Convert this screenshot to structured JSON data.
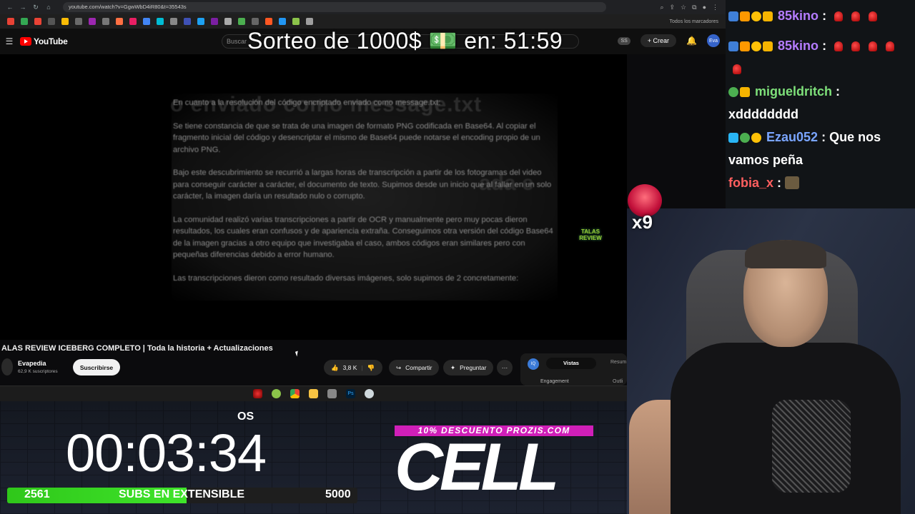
{
  "browser": {
    "url": "youtube.com/watch?v=GgwWbD4iR80&t=35543s",
    "bookmarks_folder": "Todos los marcadores"
  },
  "youtube": {
    "logo_text": "YouTube",
    "search_placeholder": "Buscar",
    "ss_badge": "SS",
    "create_label": "+ Crear",
    "avatar_label": "Eva"
  },
  "overlay_top": {
    "giveaway_text": "Sorteo de 1000$ 💵 en: 51:59"
  },
  "video": {
    "doc_heading": "En cuanto a la resolución del código encriptado enviado como message.txt:",
    "doc_ghost_1": "o enviado como message.txt",
    "doc_ghost_2": "ada e",
    "doc_paragraph_1": "Se tiene constancia de que se trata de una imagen de formato PNG codificada en Base64. Al copiar el fragmento inicial del código y desencriptar el mismo de Base64 puede notarse el encoding propio de un archivo PNG.",
    "doc_paragraph_2": "Bajo este descubrimiento se recurrió a largas horas de transcripción a partir de los fotogramas del video para conseguir carácter a carácter, el documento de texto. Supimos desde un inicio que al fallar en un solo carácter, la imagen daría un resultado nulo o corrupto.",
    "doc_paragraph_3": "La comunidad realizó varias transcripciones a partir de OCR y manualmente pero muy pocas dieron resultados, los cuales eran confusos y de apariencia extraña. Conseguimos otra versión del código Base64 de la imagen gracias a otro equipo que investigaba el caso, ambos códigos eran similares pero con pequeñas diferencias debido a error humano.",
    "doc_paragraph_4": "Las transcripciones dieron como resultado diversas imágenes, solo supimos de 2 concretamente:",
    "watermark": "TALAS REVIEW"
  },
  "video_info": {
    "title": "ALAS REVIEW ICEBERG COMPLETO | Toda la historia + Actualizaciones",
    "channel": "Evapedia",
    "subscribers": "62,9 K suscriptores",
    "subscribe_label": "Suscribirse",
    "likes": "3,8 K",
    "share_label": "Compartir",
    "ask_label": "Preguntar",
    "more_label": "···"
  },
  "side_panel": {
    "tab_active": "Vistas",
    "tab_other": "Resum",
    "engagement_label": "Engagement",
    "outline_label": "Outli"
  },
  "overlay_bottom": {
    "os_label": "OS",
    "timer": "00:03:34",
    "sub_current": "2561",
    "sub_label": "SUBS EN EXTENSIBLE",
    "sub_goal": "5000",
    "sub_progress": 0.512,
    "promo_text": "10% DESCUENTO PROZIS.COM",
    "sponsor_text": "CELL"
  },
  "donation": {
    "multiplier": "x9"
  },
  "chat": {
    "messages": [
      {
        "user": "85kino",
        "user_color": "#b57cff",
        "text": ":"
      },
      {
        "user": "85kino",
        "user_color": "#b57cff",
        "text": ":"
      },
      {
        "user": "migueldritch",
        "user_color": "#7ee07a",
        "text": ":",
        "text2": "xdddddddd"
      },
      {
        "user": "Ezau052",
        "user_color": "#7aa5ff",
        "text": ": Que nos",
        "text2": "vamos peña"
      },
      {
        "user": "fobia_x",
        "user_color": "#ff5f5f",
        "text": ":"
      }
    ]
  },
  "colors": {
    "youtube_red": "#ff0000",
    "promo_magenta": "#d01fb8",
    "sub_bar_green": "#2fc71a"
  }
}
